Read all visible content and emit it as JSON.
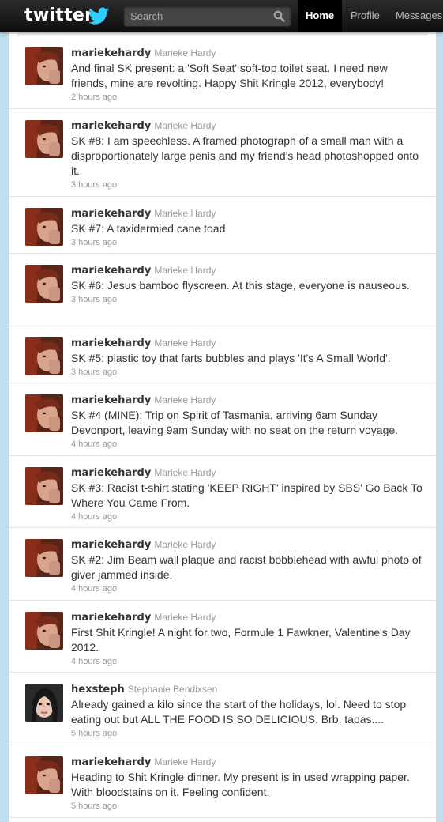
{
  "app": {
    "logo_text": "twitter",
    "colors": {
      "topbar": "#1a1a1a",
      "background": "#c0deed",
      "link": "#333333"
    }
  },
  "search": {
    "placeholder": "Search",
    "icon": "search-icon"
  },
  "nav": {
    "home": "Home",
    "profile": "Profile",
    "messages": "Messages"
  },
  "tweets": [
    {
      "screen_name": "mariekehardy",
      "full_name": "Marieke Hardy",
      "text": "And final SK present: a 'Soft Seat' soft-top toilet seat. I need new friends, mine are revolting. Happy Shit Kringle 2012, everybody!",
      "time": "2 hours ago"
    },
    {
      "screen_name": "mariekehardy",
      "full_name": "Marieke Hardy",
      "text": "SK #8: I am speechless. A framed photograph of a small man with a disproportionately large penis and my friend's head photoshopped onto it.",
      "time": "3 hours ago"
    },
    {
      "screen_name": "mariekehardy",
      "full_name": "Marieke Hardy",
      "text": "SK #7: A taxidermied cane toad.",
      "time": "3 hours ago"
    },
    {
      "screen_name": "mariekehardy",
      "full_name": "Marieke Hardy",
      "text": "SK #6: Jesus bamboo flyscreen. At this stage, everyone is nauseous.",
      "time": "3 hours ago"
    },
    {
      "screen_name": "mariekehardy",
      "full_name": "Marieke Hardy",
      "text": "SK #5: plastic toy that farts bubbles and plays 'It's A Small World'.",
      "time": "3 hours ago"
    },
    {
      "screen_name": "mariekehardy",
      "full_name": "Marieke Hardy",
      "text": "SK #4 (MINE): Trip on Spirit of Tasmania, arriving 6am Sunday Devonport, leaving 9am Sunday with no seat on the return voyage.",
      "time": "4 hours ago"
    },
    {
      "screen_name": "mariekehardy",
      "full_name": "Marieke Hardy",
      "text": "SK #3: Racist t-shirt stating 'KEEP RIGHT' inspired by SBS' Go Back To Where You Came From.",
      "time": "4 hours ago"
    },
    {
      "screen_name": "mariekehardy",
      "full_name": "Marieke Hardy",
      "text": "SK #2: Jim Beam wall plaque and racist bobblehead with awful photo of giver jammed inside.",
      "time": "4 hours ago"
    },
    {
      "screen_name": "mariekehardy",
      "full_name": "Marieke Hardy",
      "text": "First Shit Kringle! A night for two, Formule 1 Fawkner, Valentine's Day 2012.",
      "time": "4 hours ago"
    },
    {
      "screen_name": "hexsteph",
      "full_name": "Stephanie Bendixsen",
      "text": "Already gained a kilo since the start of the holidays, lol. Need to stop eating out but ALL THE FOOD IS SO DELICIOUS. Brb, tapas....",
      "time": "5 hours ago"
    },
    {
      "screen_name": "mariekehardy",
      "full_name": "Marieke Hardy",
      "text": "Heading to Shit Kringle dinner. My present is in used wrapping paper. With bloodstains on it. Feeling confident.",
      "time": "5 hours ago"
    }
  ]
}
